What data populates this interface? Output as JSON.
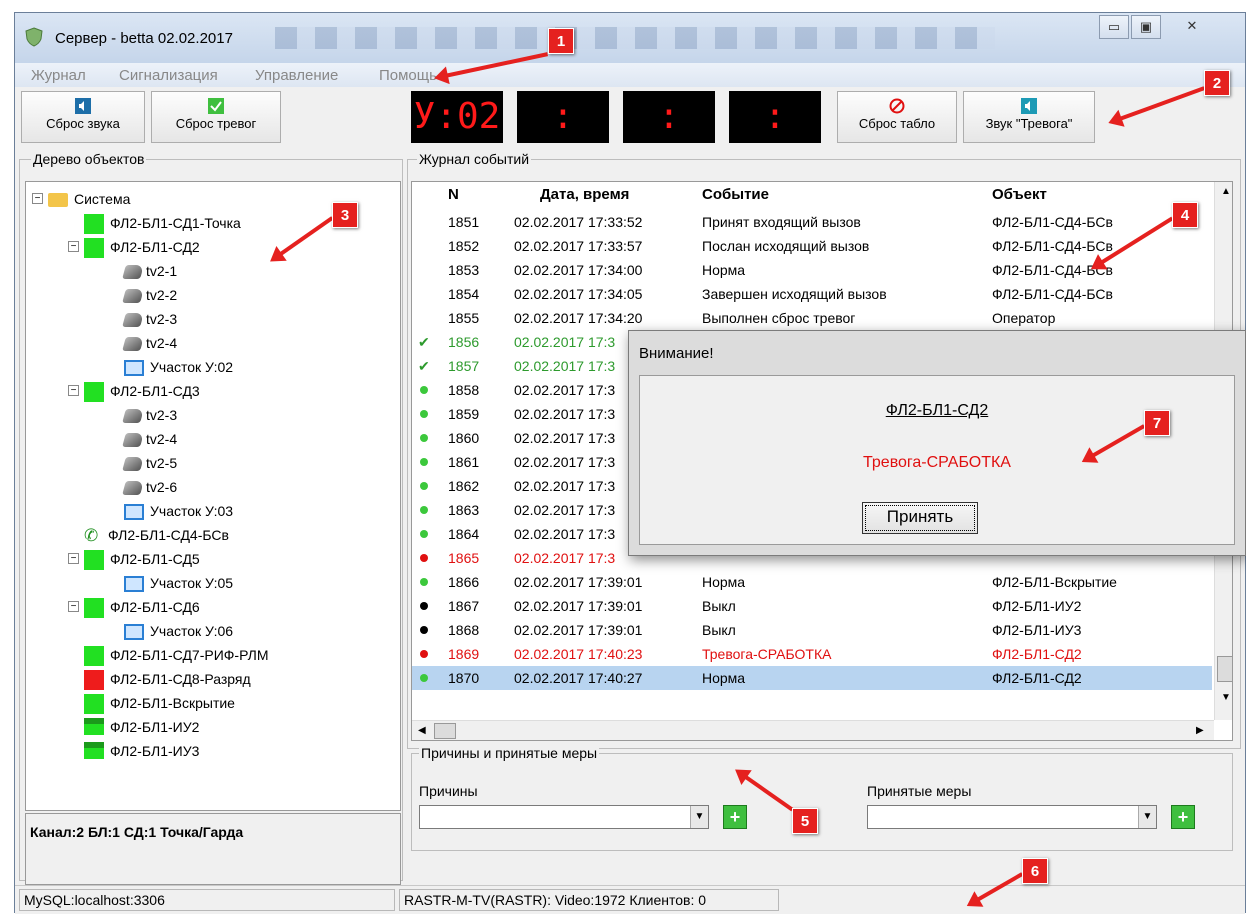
{
  "window": {
    "title": "Сервер - betta 02.02.2017",
    "buttons": [
      "▭",
      "▣",
      "✕"
    ]
  },
  "menu": [
    "Журнал",
    "Сигнализация",
    "Управление",
    "Помощь"
  ],
  "toolbar": {
    "reset_sound": "Сброс звука",
    "reset_alarms": "Сброс тревог",
    "segments": [
      "У:02",
      ":",
      ":",
      ":"
    ],
    "reset_board": "Сброс табло",
    "alarm_sound": "Звук \"Тревога\""
  },
  "tree": {
    "group_label": "Дерево объектов",
    "nodes": [
      {
        "label": "Система",
        "kind": "folder"
      },
      {
        "label": "ФЛ2-БЛ1-СД1-Точка",
        "kind": "green"
      },
      {
        "label": "ФЛ2-БЛ1-СД2",
        "kind": "green"
      },
      {
        "label": "tv2-1",
        "kind": "camera"
      },
      {
        "label": "tv2-2",
        "kind": "camera"
      },
      {
        "label": "tv2-3",
        "kind": "camera"
      },
      {
        "label": "tv2-4",
        "kind": "camera"
      },
      {
        "label": "Участок У:02",
        "kind": "monitor"
      },
      {
        "label": "ФЛ2-БЛ1-СД3",
        "kind": "green"
      },
      {
        "label": "tv2-3",
        "kind": "camera"
      },
      {
        "label": "tv2-4",
        "kind": "camera"
      },
      {
        "label": "tv2-5",
        "kind": "camera"
      },
      {
        "label": "tv2-6",
        "kind": "camera"
      },
      {
        "label": "Участок У:03",
        "kind": "monitor"
      },
      {
        "label": "ФЛ2-БЛ1-СД4-БСв",
        "kind": "phone"
      },
      {
        "label": "ФЛ2-БЛ1-СД5",
        "kind": "green"
      },
      {
        "label": "Участок У:05",
        "kind": "monitor"
      },
      {
        "label": "ФЛ2-БЛ1-СД6",
        "kind": "green"
      },
      {
        "label": "Участок У:06",
        "kind": "monitor"
      },
      {
        "label": "ФЛ2-БЛ1-СД7-РИФ-РЛМ",
        "kind": "green"
      },
      {
        "label": "ФЛ2-БЛ1-СД8-Разряд",
        "kind": "red"
      },
      {
        "label": "ФЛ2-БЛ1-Вскрытие",
        "kind": "green"
      },
      {
        "label": "ФЛ2-БЛ1-ИУ2",
        "kind": "greenbar"
      },
      {
        "label": "ФЛ2-БЛ1-ИУ3",
        "kind": "greenbar"
      }
    ],
    "status": "Канал:2 БЛ:1 СД:1 Точка/Гарда"
  },
  "log": {
    "group_label": "Журнал событий",
    "headers": [
      "N",
      "Дата, время",
      "Событие",
      "Объект"
    ],
    "rows": [
      {
        "n": "1851",
        "dt": "02.02.2017  17:33:52",
        "ev": "Принят входящий вызов",
        "obj": "ФЛ2-БЛ1-СД4-БСв",
        "mark": "",
        "color": "#000"
      },
      {
        "n": "1852",
        "dt": "02.02.2017  17:33:57",
        "ev": "Послан исходящий вызов",
        "obj": "ФЛ2-БЛ1-СД4-БСв",
        "mark": "",
        "color": "#000"
      },
      {
        "n": "1853",
        "dt": "02.02.2017  17:34:00",
        "ev": "Норма",
        "obj": "ФЛ2-БЛ1-СД4-БСв",
        "mark": "",
        "color": "#000"
      },
      {
        "n": "1854",
        "dt": "02.02.2017  17:34:05",
        "ev": "Завершен исходящий вызов",
        "obj": "ФЛ2-БЛ1-СД4-БСв",
        "mark": "",
        "color": "#000"
      },
      {
        "n": "1855",
        "dt": "02.02.2017  17:34:20",
        "ev": "Выполнен сброс тревог",
        "obj": "Оператор",
        "mark": "",
        "color": "#000"
      },
      {
        "n": "1856",
        "dt": "02.02.2017  17:3",
        "ev": "",
        "obj": "",
        "mark": "check",
        "color": "#2d9a2d"
      },
      {
        "n": "1857",
        "dt": "02.02.2017  17:3",
        "ev": "",
        "obj": "",
        "mark": "check",
        "color": "#2d9a2d"
      },
      {
        "n": "1858",
        "dt": "02.02.2017  17:3",
        "ev": "",
        "obj": "",
        "mark": "green",
        "color": "#000"
      },
      {
        "n": "1859",
        "dt": "02.02.2017  17:3",
        "ev": "",
        "obj": "",
        "mark": "green",
        "color": "#000"
      },
      {
        "n": "1860",
        "dt": "02.02.2017  17:3",
        "ev": "",
        "obj": "",
        "mark": "green",
        "color": "#000"
      },
      {
        "n": "1861",
        "dt": "02.02.2017  17:3",
        "ev": "",
        "obj": "",
        "mark": "green",
        "color": "#000"
      },
      {
        "n": "1862",
        "dt": "02.02.2017  17:3",
        "ev": "",
        "obj": "",
        "mark": "green",
        "color": "#000"
      },
      {
        "n": "1863",
        "dt": "02.02.2017  17:3",
        "ev": "",
        "obj": "",
        "mark": "green",
        "color": "#000"
      },
      {
        "n": "1864",
        "dt": "02.02.2017  17:3",
        "ev": "",
        "obj": "",
        "mark": "green",
        "color": "#000"
      },
      {
        "n": "1865",
        "dt": "02.02.2017  17:3",
        "ev": "",
        "obj": "",
        "mark": "red",
        "color": "#e01010"
      },
      {
        "n": "1866",
        "dt": "02.02.2017  17:39:01",
        "ev": "Норма",
        "obj": "ФЛ2-БЛ1-Вскрытие",
        "mark": "green",
        "color": "#000"
      },
      {
        "n": "1867",
        "dt": "02.02.2017  17:39:01",
        "ev": "Выкл",
        "obj": "ФЛ2-БЛ1-ИУ2",
        "mark": "black",
        "color": "#000"
      },
      {
        "n": "1868",
        "dt": "02.02.2017  17:39:01",
        "ev": "Выкл",
        "obj": "ФЛ2-БЛ1-ИУ3",
        "mark": "black",
        "color": "#000"
      },
      {
        "n": "1869",
        "dt": "02.02.2017  17:40:23",
        "ev": "Тревога-СРАБОТКА",
        "obj": "ФЛ2-БЛ1-СД2",
        "mark": "red",
        "color": "#e01010"
      },
      {
        "n": "1870",
        "dt": "02.02.2017  17:40:27",
        "ev": "Норма",
        "obj": "ФЛ2-БЛ1-СД2",
        "mark": "green",
        "color": "#000"
      }
    ]
  },
  "measures": {
    "group_label": "Причины и принятые меры",
    "causes_label": "Причины",
    "actions_label": "Принятые меры"
  },
  "statusbar": {
    "db": "MySQL:localhost:3306",
    "server": "RASTR-M-TV(RASTR): Video:1972 Клиентов: 0"
  },
  "dialog": {
    "title": "Внимание!",
    "object": "ФЛ2-БЛ1-СД2",
    "message": "Тревога-СРАБОТКА",
    "accept": "Принять"
  },
  "callouts": [
    "1",
    "2",
    "3",
    "4",
    "5",
    "6",
    "7"
  ]
}
